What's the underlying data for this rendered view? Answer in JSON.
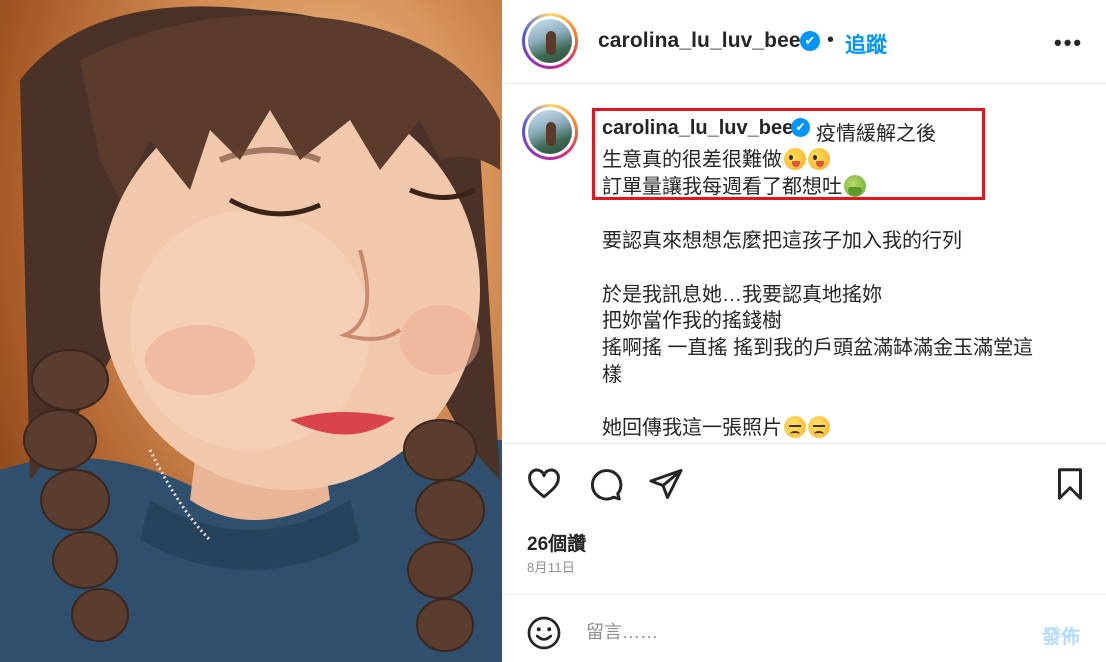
{
  "header": {
    "username": "carolina_lu_luv_bee",
    "verified_mark": "✔",
    "separator": "•",
    "follow_label": "追蹤",
    "more_label": "•••"
  },
  "caption": {
    "username": "carolina_lu_luv_bee",
    "verified_mark": "✔",
    "lines": [
      "疫情緩解之後",
      "生意真的很差很難做",
      "訂單量讓我每週看了都想吐",
      "要認真來想想怎麼把這孩子加入我的行列",
      "於是我訊息她…我要認真地搖妳",
      "把妳當作我的搖錢樹",
      "搖啊搖 一直搖 搖到我的戶頭盆滿缽滿金玉滿堂這",
      "樣",
      "她回傳我這一張照片"
    ],
    "emojis": {
      "line2": [
        "zany-face-emoji",
        "zany-face-emoji"
      ],
      "line3": [
        "vomiting-face-emoji"
      ],
      "line9": [
        "unamused-face-emoji",
        "unamused-face-emoji"
      ]
    },
    "highlight_color": "#e3141c"
  },
  "actions": {
    "likes": "26個讚",
    "date": "8月11日"
  },
  "comment": {
    "placeholder": "留言……",
    "post_label": "發佈"
  },
  "colors": {
    "accent": "#0095f6",
    "post_disabled": "#b3dbff",
    "muted": "#8e8e8e"
  }
}
